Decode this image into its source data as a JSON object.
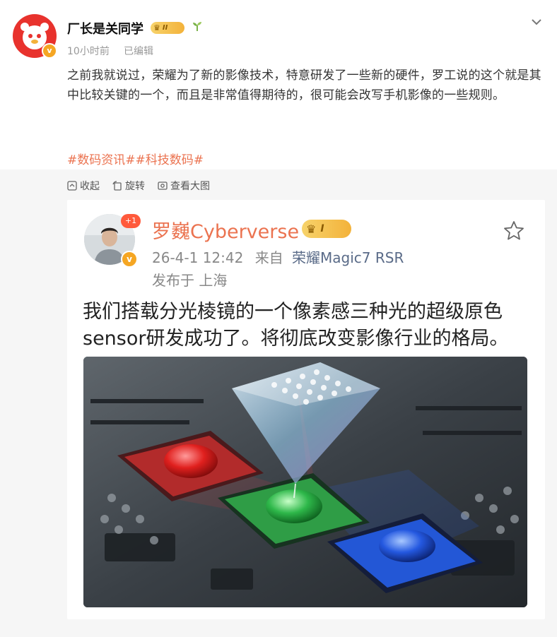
{
  "post": {
    "author": {
      "name": "厂长是关同学",
      "badge_level": "II",
      "verified": "v"
    },
    "meta": {
      "time": "10小时前",
      "edited": "已编辑"
    },
    "text": "之前我就说过，荣耀为了新的影像技术，特意研发了一些新的硬件，罗工说的这个就是其中比较关键的一个，而且是非常值得期待的，很可能会改写手机影像的一些规则。",
    "hashtags": "#数码资讯##科技数码#",
    "icons": [
      "chevron-down-icon",
      "sprout-icon",
      "crown-icon"
    ]
  },
  "toolbar": {
    "collapse": "收起",
    "rotate": "旋转",
    "view_large": "查看大图"
  },
  "embedded": {
    "author": {
      "name": "罗巍Cyberverse",
      "badge_level": "I",
      "notification": "+1",
      "verified": "v"
    },
    "meta": {
      "date": "26-4-1 12:42",
      "from": "来自",
      "source": "荣耀Magic7 RSR"
    },
    "location": "发布于 上海",
    "text": "我们搭载分光棱镜的一个像素感三种光的超级原色sensor研发成功了。将彻底改变影像行业的格局。",
    "image_desc_icons": [
      "star-icon"
    ]
  },
  "colors": {
    "link": "#eb7350",
    "muted": "#999999",
    "gold": "#f3b23a",
    "brand_red": "#e8322d",
    "gray_bg": "#f6f6f6"
  }
}
